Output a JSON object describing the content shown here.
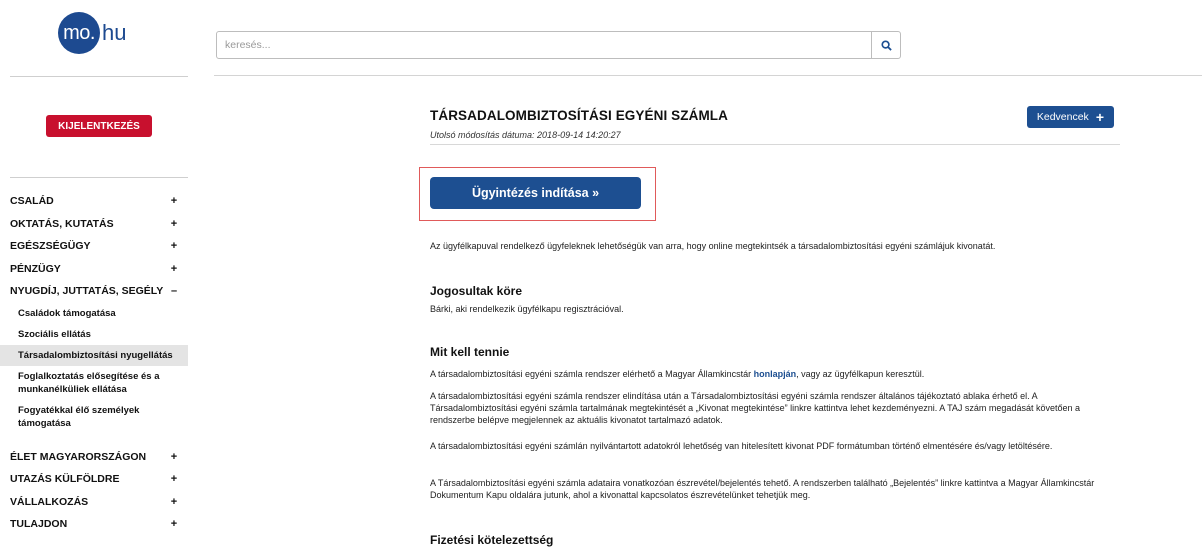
{
  "logo": {
    "circle_text": "mo.",
    "suffix_text": "hu"
  },
  "sidebar": {
    "logout_label": "KIJELENTKEZÉS",
    "nav_items": [
      {
        "label": "CSALÁD",
        "sign": "+"
      },
      {
        "label": "OKTATÁS, KUTATÁS",
        "sign": "+"
      },
      {
        "label": "EGÉSZSÉGÜGY",
        "sign": "+"
      },
      {
        "label": "PÉNZÜGY",
        "sign": "+"
      },
      {
        "label": "NYUGDÍJ, JUTTATÁS, SEGÉLY",
        "sign": "–"
      }
    ],
    "sub_items": [
      {
        "label": "Családok támogatása"
      },
      {
        "label": "Szociális ellátás"
      },
      {
        "label": "Társadalombiztosítási nyugellátás"
      },
      {
        "label": "Foglalkoztatás elősegítése és a munkanélküliek ellátása"
      },
      {
        "label": "Fogyatékkal élő személyek támogatása"
      }
    ],
    "nav_items_after": [
      {
        "label": "ÉLET MAGYARORSZÁGON",
        "sign": "+"
      },
      {
        "label": "UTAZÁS KÜLFÖLDRE",
        "sign": "+"
      },
      {
        "label": "VÁLLALKOZÁS",
        "sign": "+"
      },
      {
        "label": "TULAJDON",
        "sign": "+"
      }
    ]
  },
  "search": {
    "placeholder": "keresés...",
    "icon": "search-icon"
  },
  "main": {
    "title": "TÁRSADALOMBIZTOSÍTÁSI EGYÉNI SZÁMLA",
    "modified": "Utolsó módosítás dátuma: 2018-09-14 14:20:27",
    "favorites_label": "Kedvencek",
    "favorites_plus": "+",
    "start_label": "Ügyintézés indítása »",
    "intro": "Az ügyfélkapuval rendelkező ügyfeleknek lehetőségük van arra, hogy online megtekintsék a társadalombiztosítási egyéni számlájuk kivonatát.",
    "sections": {
      "eligible_heading": "Jogosultak köre",
      "eligible_text": "Bárki, aki rendelkezik ügyfélkapu regisztrációval.",
      "todo_heading": "Mit kell tennie",
      "todo_p1_before": "A társadalombiztosítási egyéni számla rendszer elérhető a Magyar Államkincstár ",
      "todo_p1_link": "honlapján",
      "todo_p1_after": ", vagy az ügyfélkapun keresztül.",
      "todo_p2": "A társadalombiztosítási egyéni számla rendszer elindítása után a Társadalombiztosítási egyéni számla rendszer általános tájékoztató ablaka érhető el. A Társadalombiztosítási egyéni számla tartalmának megtekintését a „Kivonat megtekintése” linkre kattintva lehet kezdeményezni. A TAJ szám megadását követően a rendszerbe belépve megjelennek az aktuális kivonatot tartalmazó adatok.",
      "todo_p3": "A társadalombiztosítási egyéni számlán nyilvántartott adatokról lehetőség van hitelesített kivonat PDF formátumban történő elmentésére és/vagy letöltésére.",
      "todo_p4": "A Társadalombiztosítási egyéni számla adataira vonatkozóan észrevétel/bejelentés tehető. A rendszerben található „Bejelentés” linkre kattintva a Magyar Államkincstár Dokumentum Kapu oldalára jutunk, ahol a kivonattal kapcsolatos észrevételünket tehetjük meg.",
      "payment_heading": "Fizetési kötelezettség"
    }
  }
}
